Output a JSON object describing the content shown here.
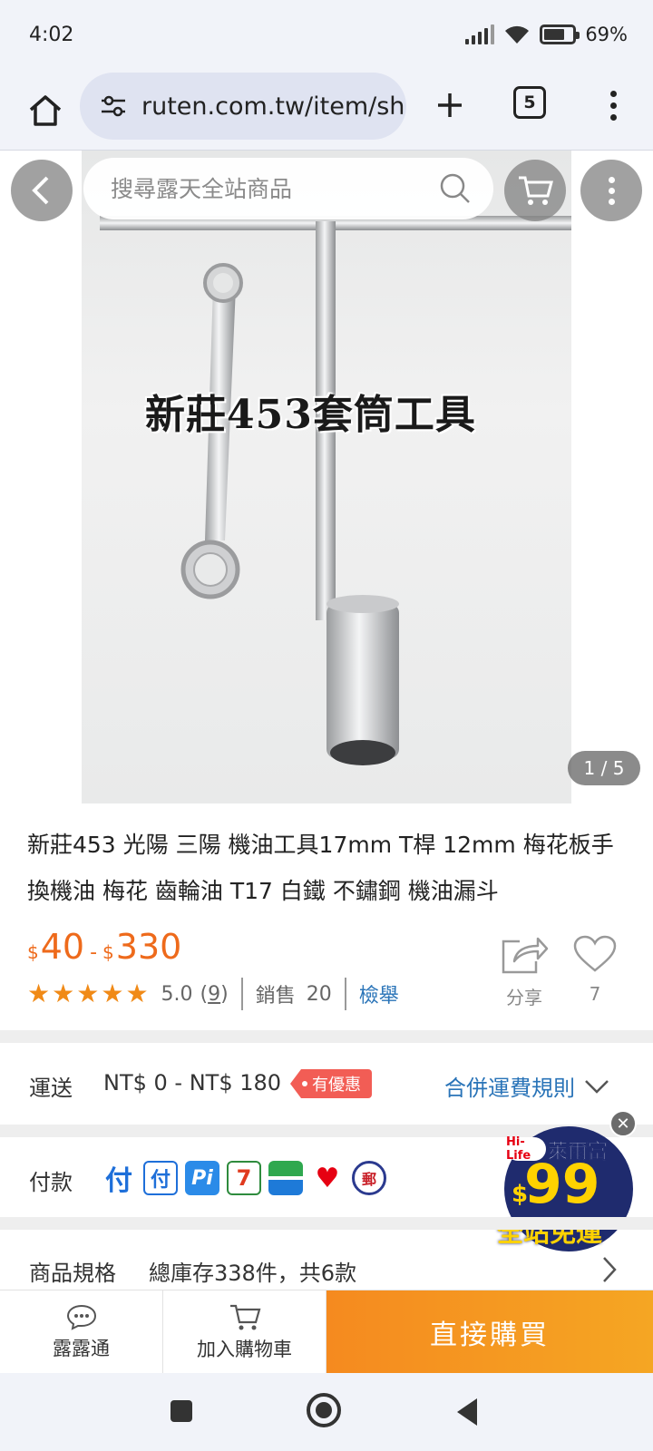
{
  "status_bar": {
    "time": "4:02",
    "battery": "69%"
  },
  "browser": {
    "url": "ruten.com.tw/item/sh",
    "tab_count": "5"
  },
  "search": {
    "placeholder": "搜尋露天全站商品"
  },
  "gallery": {
    "watermark": "新莊453套筒工具",
    "counter": "1 / 5"
  },
  "product": {
    "title": "新莊453 光陽 三陽 機油工具17mm T桿 12mm 梅花板手 換機油 梅花 齒輪油 T17 白鐵 不鏽鋼 機油漏斗",
    "price_currency": "$",
    "price_min": "40",
    "price_dash": "-",
    "price_max": "330",
    "rating_score": "5.0",
    "rating_count_open": "(",
    "rating_count": "9",
    "rating_count_close": ")",
    "sales_label": "銷售",
    "sales_count": "20",
    "report_label": "檢舉",
    "share_label": "分享",
    "like_count": "7",
    "stars": 5
  },
  "shipping": {
    "label": "運送",
    "value": "NT$ 0 - NT$ 180",
    "promo": "有優惠",
    "rules_link": "合併運費規則"
  },
  "payment": {
    "label": "付款"
  },
  "hilife_ad": {
    "brand": "萊爾富",
    "logo_text": "Hi-Life",
    "currency": "$",
    "amount": "99",
    "text": "全站免運"
  },
  "specs": {
    "label": "商品規格",
    "value": "總庫存338件，共6款"
  },
  "action_bar": {
    "chat_label": "露露通",
    "cart_label": "加入購物車",
    "buy_label": "直接購買"
  },
  "colors": {
    "accent_orange": "#ee6a1b",
    "link_blue": "#2a74b8",
    "promo_red": "#f25d55",
    "hilife_navy": "#1f2b6e",
    "hilife_yellow": "#ffd200"
  }
}
